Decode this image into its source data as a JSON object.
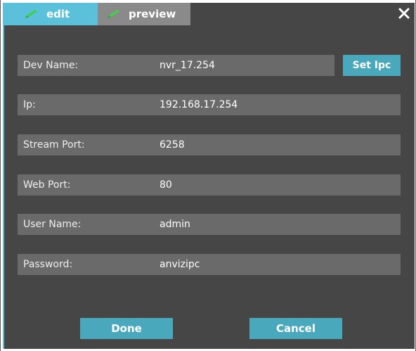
{
  "tabs": {
    "edit_label": "edit",
    "preview_label": "preview",
    "active": "edit"
  },
  "fields": {
    "dev_name": {
      "label": "Dev Name:",
      "value": "nvr_17.254"
    },
    "ip": {
      "label": "Ip:",
      "value": "192.168.17.254"
    },
    "stream_port": {
      "label": "Stream Port:",
      "value": "6258"
    },
    "web_port": {
      "label": "Web Port:",
      "value": "80"
    },
    "user_name": {
      "label": "User Name:",
      "value": "admin"
    },
    "password": {
      "label": "Password:",
      "value": "anvizipc"
    }
  },
  "buttons": {
    "set_ipc": "Set Ipc",
    "done": "Done",
    "cancel": "Cancel"
  },
  "icons": {
    "tab_icon": "pencil-icon",
    "close": "close-icon"
  },
  "colors": {
    "accent": "#5bc0d9",
    "button": "#4aa8bd",
    "background": "#464646",
    "field": "#6a6a6a",
    "inactive_tab": "#8a8a8a",
    "pencil": "#3dd24a"
  }
}
